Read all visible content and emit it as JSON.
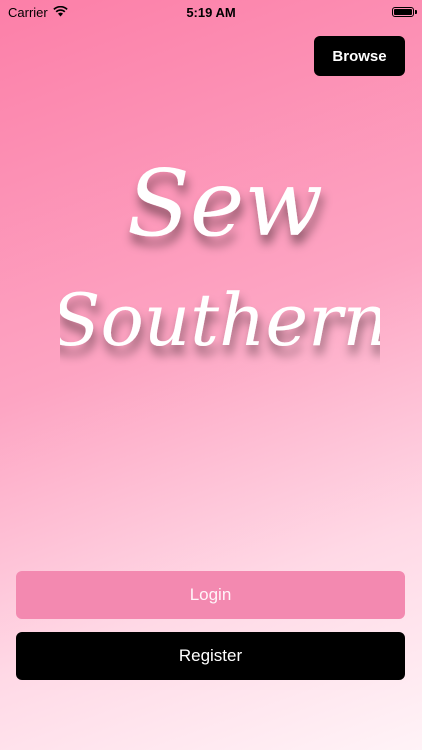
{
  "status_bar": {
    "carrier": "Carrier",
    "time": "5:19 AM",
    "wifi_icon": "wifi-icon",
    "battery_icon": "battery-icon"
  },
  "header": {
    "browse_label": "Browse"
  },
  "logo": {
    "line1": "Sew",
    "line2": "Southern"
  },
  "actions": {
    "login_label": "Login",
    "register_label": "Register"
  },
  "colors": {
    "login_bg": "#f389b0",
    "register_bg": "#000000",
    "browse_bg": "#000000"
  }
}
